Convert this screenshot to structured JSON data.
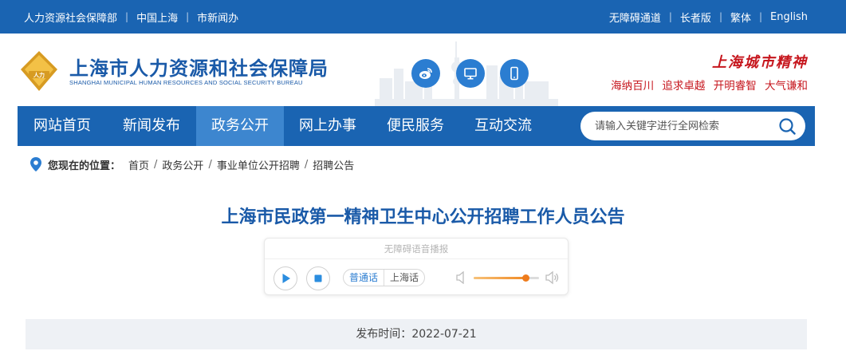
{
  "topbar": {
    "left_links": [
      "人力资源社会保障部",
      "中国上海",
      "市新闻办"
    ],
    "right_links": [
      "无障碍通道",
      "长者版",
      "繁体",
      "English"
    ]
  },
  "header": {
    "title": "上海市人力资源和社会保障局",
    "subtitle": "SHANGHAI MUNICIPAL HUMAN RESOURCES AND SOCIAL SECURITY BUREAU",
    "emblem_text": "人力",
    "social_icons": [
      "weibo-icon",
      "desktop-icon",
      "mobile-icon"
    ],
    "spirit_title": "上海城市精神",
    "spirit_phrases": [
      "海纳百川",
      "追求卓越",
      "开明睿智",
      "大气谦和"
    ]
  },
  "nav": {
    "items": [
      "网站首页",
      "新闻发布",
      "政务公开",
      "网上办事",
      "便民服务",
      "互动交流"
    ],
    "active_index": 2,
    "search_placeholder": "请输入关键字进行全网检索"
  },
  "breadcrumb": {
    "label": "您现在的位置：",
    "items": [
      "首页",
      "政务公开",
      "事业单位公开招聘",
      "招聘公告"
    ]
  },
  "article": {
    "title": "上海市民政第一精神卫生中心公开招聘工作人员公告",
    "publish_label": "发布时间：",
    "publish_date": "2022-07-21"
  },
  "player": {
    "header": "无障碍语音播报",
    "lang_options": [
      "普通话",
      "上海话"
    ],
    "selected_lang": "普通话",
    "volume": 0.8
  },
  "colors": {
    "primary": "#1a64b2",
    "nav_active": "#3d86cf",
    "title": "#1a5aa8",
    "spirit": "#c6161d",
    "accent_orange": "#ee7b1c"
  }
}
